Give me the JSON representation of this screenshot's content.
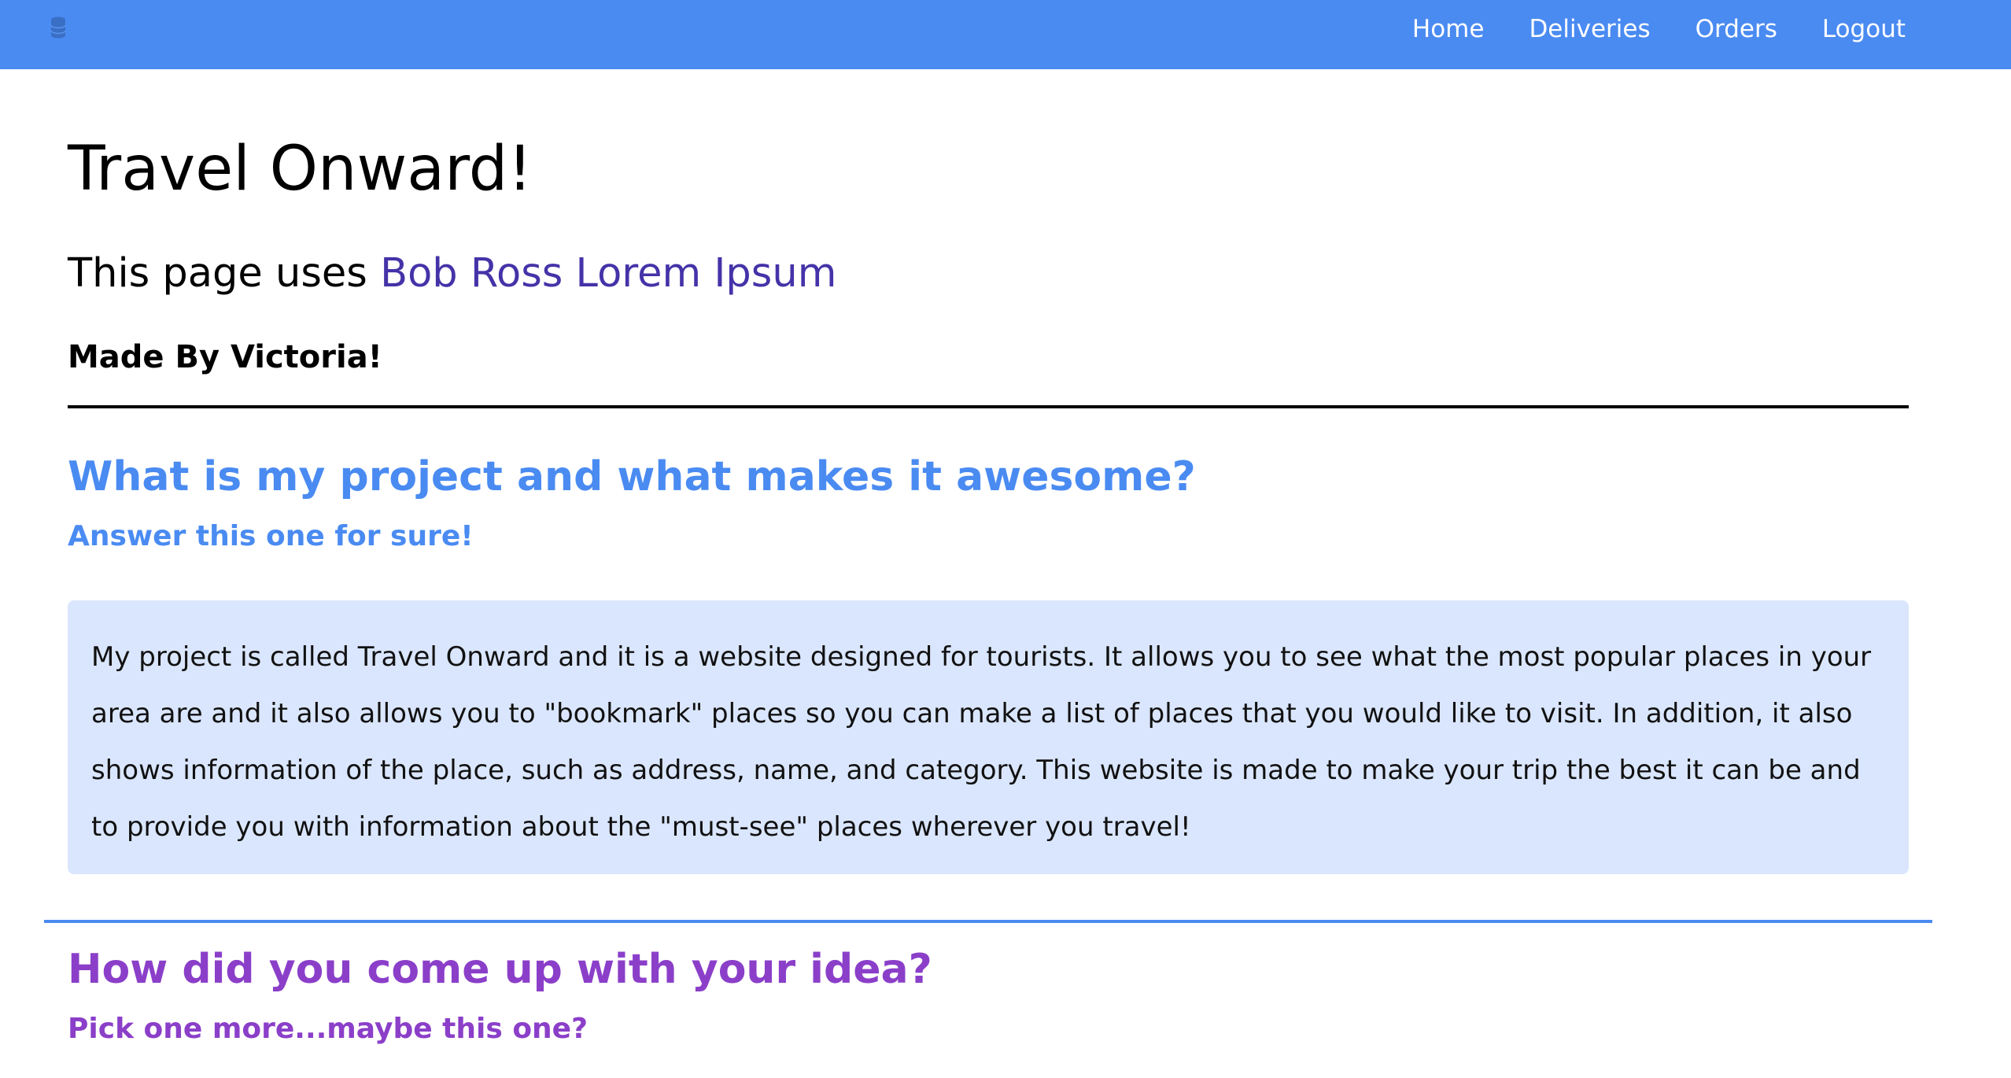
{
  "nav": {
    "logo_icon": "database-icon",
    "links": [
      "Home",
      "Deliveries",
      "Orders",
      "Logout"
    ]
  },
  "page": {
    "title": "Travel Onward!",
    "subtitle_prefix": "This page uses ",
    "subtitle_link": "Bob Ross Lorem Ipsum",
    "byline": "Made By Victoria!"
  },
  "section1": {
    "question": "What is my project and what makes it awesome?",
    "hint": "Answer this one for sure!",
    "answer": "My project is called Travel Onward and it is a website designed for tourists. It allows you to see what the most popular places in your area are and it also allows you to \"bookmark\" places so you can make a list of places that you would like to visit. In addition, it also shows information of the place, such as address, name, and category. This website is made to make your trip the best it can be and to provide you with information about the \"must-see\" places wherever you travel!"
  },
  "section2": {
    "question": "How did you come up with your idea?",
    "hint": "Pick one more...maybe this one?"
  },
  "colors": {
    "navbar": "#4a8bf2",
    "link": "#4433a8",
    "section1_accent": "#4a8bf2",
    "section2_accent": "#8b3fc9",
    "answer_background": "#dae6fd"
  }
}
